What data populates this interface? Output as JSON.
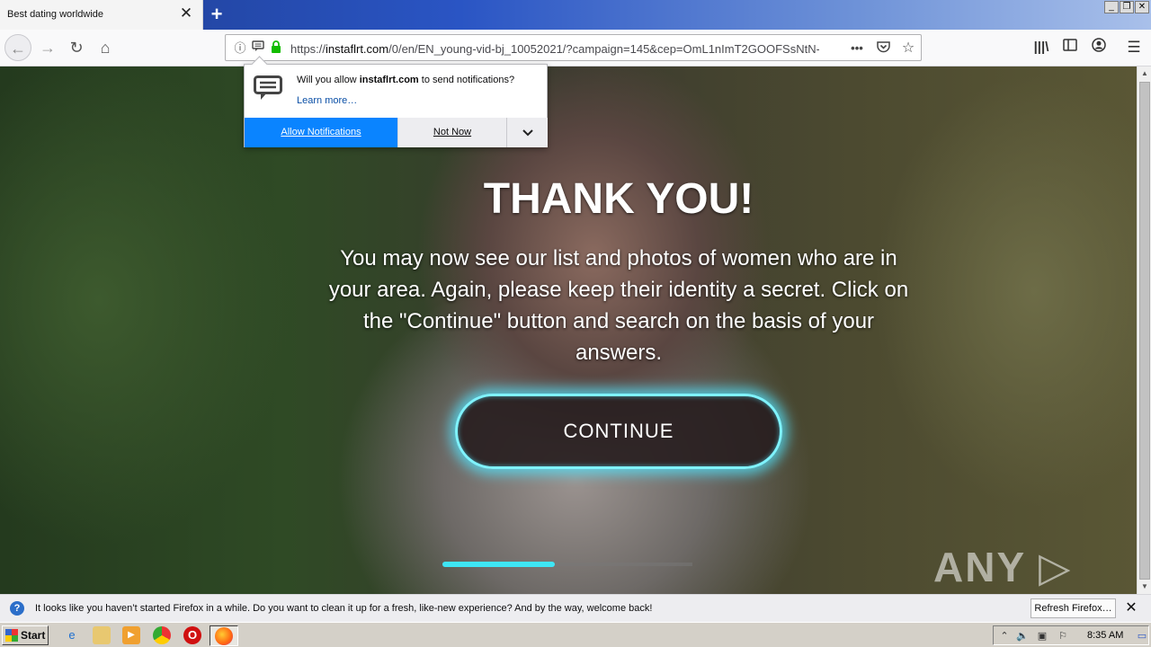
{
  "browser": {
    "tab_title": "Best dating worldwide",
    "tab_close": "✕",
    "new_tab": "+",
    "url_prefix": "https://",
    "url_host": "instaflrt.com",
    "url_path": "/0/en/EN_young-vid-bj_10052021/?campaign=145&cep=OmL1nImT2GOOFSsNtN-",
    "page_actions": "•••"
  },
  "notification_popup": {
    "message_prefix": "Will you allow ",
    "message_host": "instaflrt.com",
    "message_suffix": " to send notifications?",
    "learn_more": "Learn more…",
    "allow_label": "Allow Notifications",
    "not_now_label": "Not Now"
  },
  "page": {
    "headline": "THANK YOU!",
    "body": "You may now see our list and photos of women who are in your area. Again, please keep their identity a secret. Click on the \"Continue\" button and search on the basis of your answers.",
    "cta_label": "CONTINUE",
    "progress": 0.45,
    "watermark": "ANY ▷ RUN"
  },
  "infobar": {
    "message": "It looks like you haven’t started Firefox in a while. Do you want to clean it up for a fresh, like-new experience? And by the way, welcome back!",
    "button_label": "Refresh Firefox…"
  },
  "taskbar": {
    "start_label": "Start",
    "clock": "8:35 AM"
  },
  "colors": {
    "allow_button": "#0a84ff",
    "cta_glow": "#3ee6f5",
    "titlebar": "#2a55c4"
  }
}
